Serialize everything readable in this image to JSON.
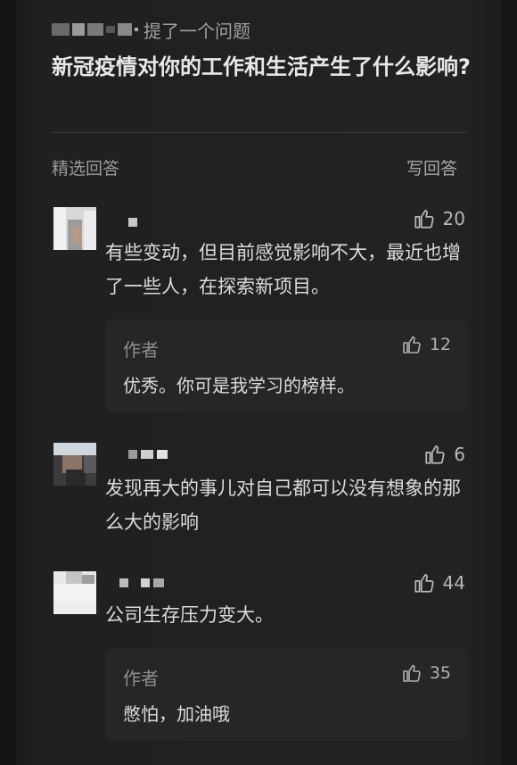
{
  "question": {
    "asker_action": "提了一个问题",
    "title": "新冠疫情对你的工作和生活产生了什么影响?"
  },
  "section": {
    "featured_label": "精选回答",
    "write_answer_label": "写回答"
  },
  "answers": [
    {
      "likes": "20",
      "text": "有些变动，但目前感觉影响不大，最近也增了一些人，在探索新项目。",
      "reply": {
        "author_label": "作者",
        "text": "优秀。你可是我学习的榜样。",
        "likes": "12"
      }
    },
    {
      "likes": "6",
      "text": "发现再大的事儿对自己都可以没有想象的那么大的影响"
    },
    {
      "likes": "44",
      "text": "公司生存压力变大。",
      "reply": {
        "author_label": "作者",
        "text": "憋怕，加油哦",
        "likes": "35"
      }
    }
  ],
  "icons": {
    "like": "thumbs-up-icon"
  },
  "colors": {
    "background": "#1e1e1e",
    "card": "#262626",
    "text_primary": "#dcdcdc",
    "text_secondary": "#9a9a9a"
  }
}
